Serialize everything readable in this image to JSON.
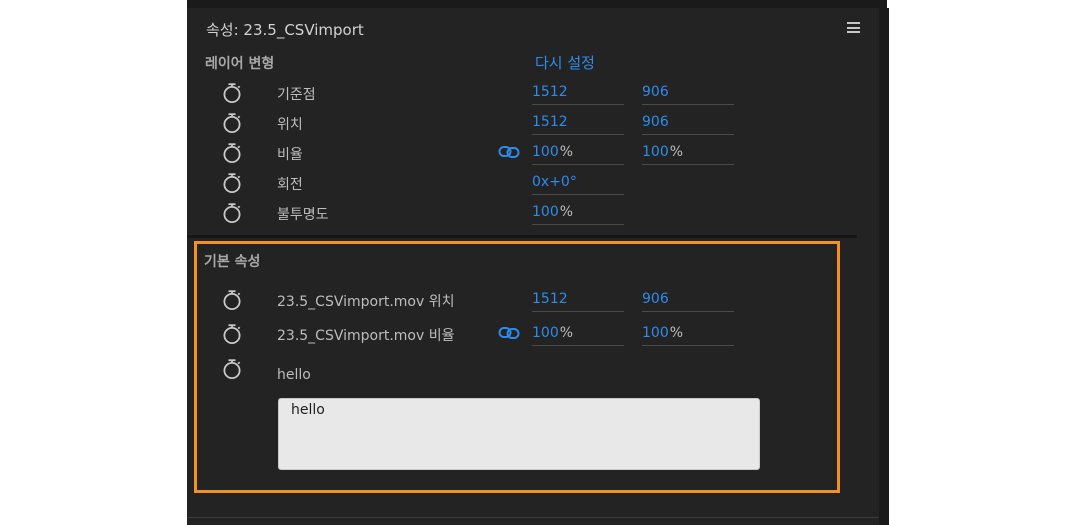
{
  "panel": {
    "title": "속성: 23.5_CSVimport"
  },
  "layer_transform": {
    "section_title": "레이어 변형",
    "reset_label": "다시 설정",
    "rows": [
      {
        "label": "기준점",
        "v1": "1512",
        "v2": "906"
      },
      {
        "label": "위치",
        "v1": "1512",
        "v2": "906"
      },
      {
        "label": "비율",
        "v1": "100",
        "u1": "%",
        "v2": "100",
        "u2": "%"
      },
      {
        "label": "회전",
        "v1": "0x+0°"
      },
      {
        "label": "불투명도",
        "v1": "100",
        "u1": "%"
      }
    ]
  },
  "basic_properties": {
    "section_title": "기본 속성",
    "rows": [
      {
        "label": "23.5_CSVimport.mov 위치",
        "v1": "1512",
        "v2": "906"
      },
      {
        "label": "23.5_CSVimport.mov 비율",
        "v1": "100",
        "u1": "%",
        "v2": "100",
        "u2": "%"
      },
      {
        "label": "hello"
      }
    ],
    "text_value": "hello"
  },
  "colors": {
    "panel_bg": "#232323",
    "value_blue": "#2d8ceb",
    "highlight_orange": "#f39223"
  },
  "icons": {
    "stopwatch": "stopwatch-icon",
    "link": "link-icon",
    "menu": "hamburger-menu-icon"
  }
}
